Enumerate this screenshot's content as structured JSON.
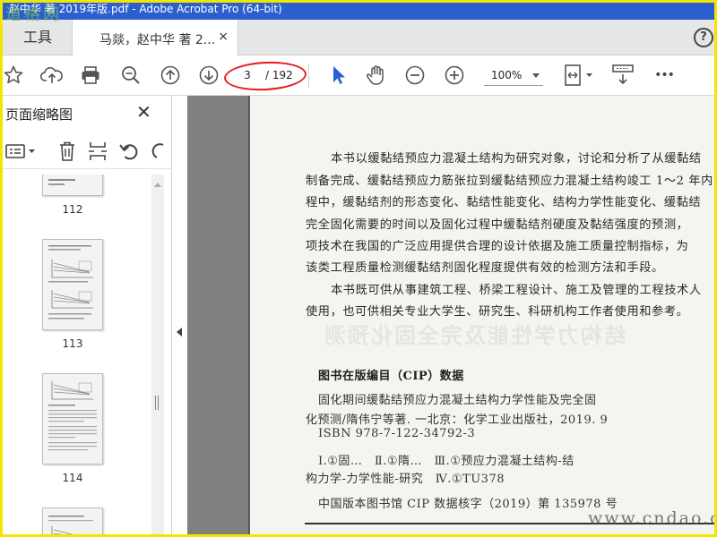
{
  "window": {
    "title": "赵中华 著 2019年版.pdf - Adobe Acrobat Pro (64-bit)",
    "watermark_top_left": "道格网"
  },
  "tabs": {
    "tools_label": "工具",
    "doc_label": "马燚，赵中华 著 2...",
    "close_glyph": "×",
    "help_glyph": "?"
  },
  "toolbar": {
    "current_page": "3",
    "total_pages": "/ 192",
    "zoom": "100%",
    "more_glyph": "•••",
    "highlight_color": "#e51c1c",
    "select_tool_color": "#2a5fd6"
  },
  "sidebar": {
    "title": "页面缩略图",
    "close_glyph": "✕",
    "thumbnails": [
      {
        "label": "112"
      },
      {
        "label": "113"
      },
      {
        "label": "114"
      },
      {
        "label": ""
      }
    ]
  },
  "document": {
    "body_lines": [
      "本书以缓黏结预应力混凝土结构为研究对象，讨论和分析了从缓黏结",
      "制备完成、缓黏结预应力筋张拉到缓黏结预应力混凝土结构竣工 1～2 年内",
      "程中，缓黏结剂的形态变化、黏结性能变化、结构力学性能变化、缓黏结",
      "完全固化需要的时间以及固化过程中缓黏结剂硬度及黏结强度的预测，",
      "项技术在我国的广泛应用提供合理的设计依据及施工质量控制指标，为",
      "该类工程质量检测缓黏结剂固化程度提供有效的检测方法和手段。",
      "本书既可供从事建筑工程、桥梁工程设计、施工及管理的工程技术人",
      "使用，也可供相关专业大学生、研究生、科研机构工作者使用和参考。"
    ],
    "ghost_text": "结构力学性能及完全固化预测",
    "cip_heading": "图书在版编目（CIP）数据",
    "cip_lines": [
      "固化期间缓黏结预应力混凝土结构力学性能及完全固",
      "化预测/隋伟宁等著. 一北京：化学工业出版社，2019. 9",
      "ISBN 978-7-122-34792-3",
      "Ⅰ.①固…　Ⅱ.①隋…　Ⅲ.①预应力混凝土结构-结",
      "构力学-力学性能-研究　Ⅳ.①TU378",
      "中国版本图书馆 CIP 数据核字（2019）第 135978 号"
    ],
    "watermark_bottom_right": "www.cndao.com"
  }
}
